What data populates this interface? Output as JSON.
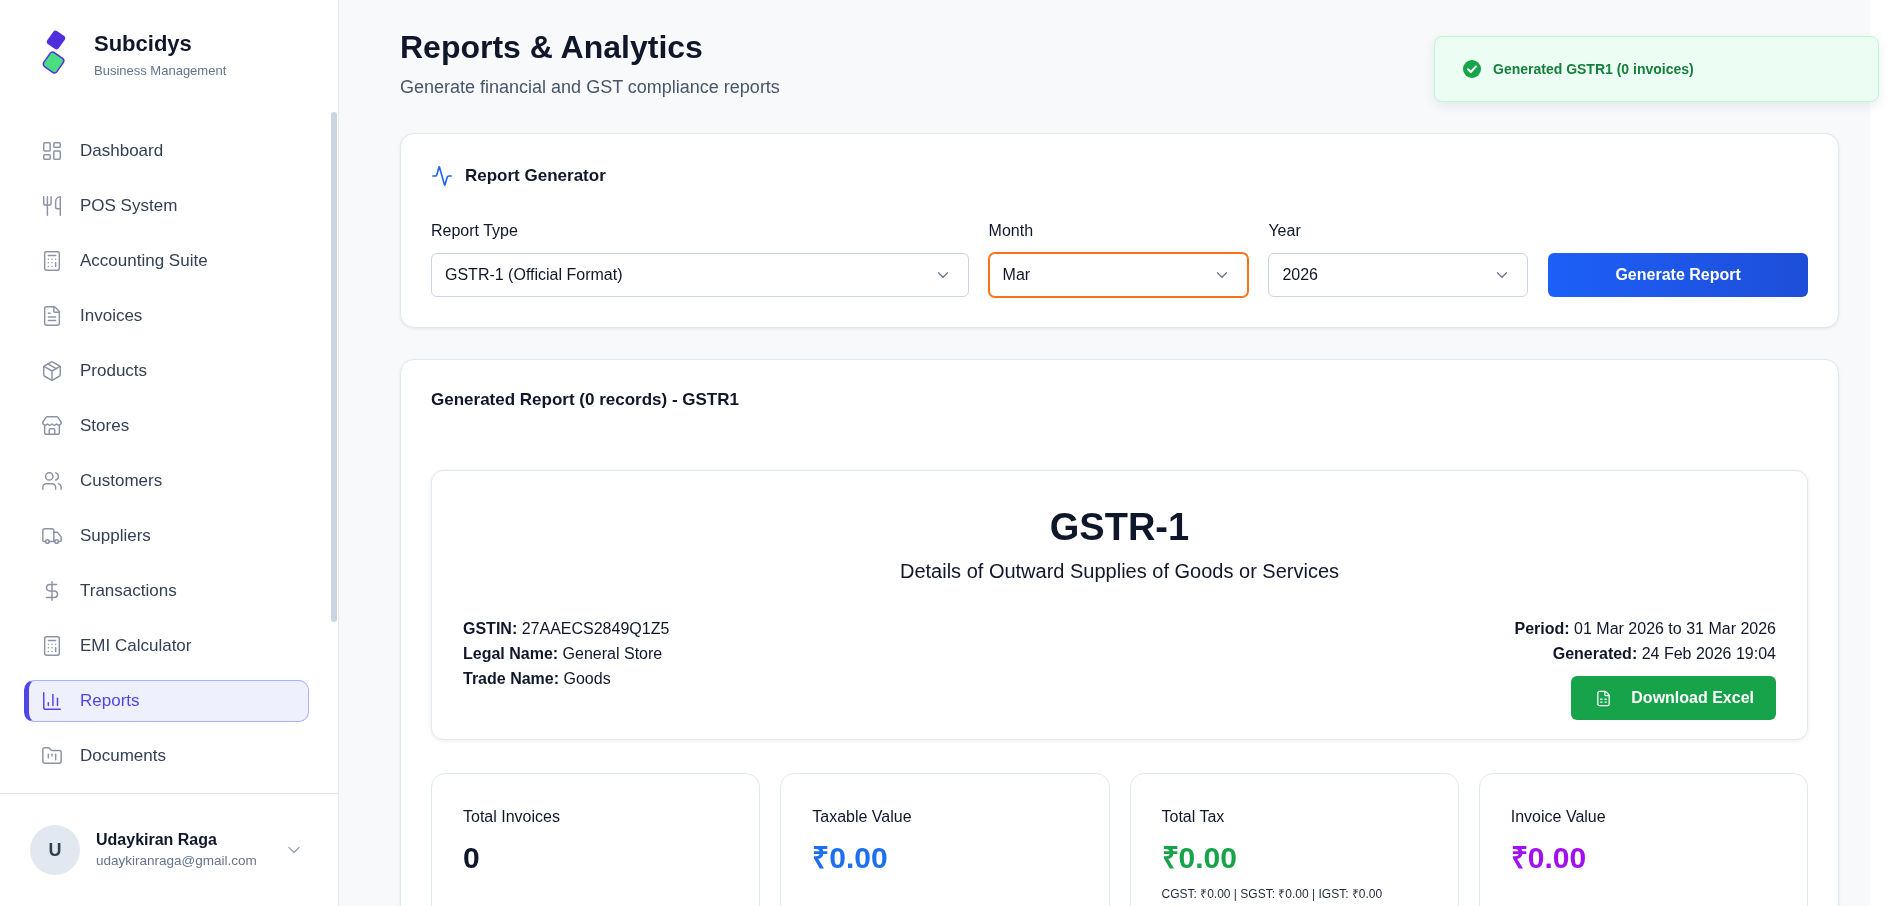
{
  "sidebar": {
    "brand": {
      "name": "Subcidys",
      "tagline": "Business Management"
    },
    "nav_items": [
      {
        "label": "Dashboard",
        "selected": false
      },
      {
        "label": "POS System",
        "selected": false
      },
      {
        "label": "Accounting Suite",
        "selected": false
      },
      {
        "label": "Invoices",
        "selected": false
      },
      {
        "label": "Products",
        "selected": false
      },
      {
        "label": "Stores",
        "selected": false
      },
      {
        "label": "Customers",
        "selected": false
      },
      {
        "label": "Suppliers",
        "selected": false
      },
      {
        "label": "Transactions",
        "selected": false
      },
      {
        "label": "EMI Calculator",
        "selected": false
      },
      {
        "label": "Reports",
        "selected": true
      },
      {
        "label": "Documents",
        "selected": false
      }
    ],
    "user": {
      "initial": "U",
      "name": "Udaykiran Raga",
      "email": "udaykiranraga@gmail.com"
    }
  },
  "header": {
    "title": "Reports & Analytics",
    "subtitle": "Generate financial and GST compliance reports"
  },
  "toast": {
    "message": "Generated GSTR1 (0 invoices)"
  },
  "report_generator": {
    "title": "Report Generator",
    "fields": [
      {
        "label": "Report Type",
        "value": "GSTR-1 (Official Format)",
        "focused": false
      },
      {
        "label": "Month",
        "value": "Mar",
        "focused": true
      },
      {
        "label": "Year",
        "value": "2026",
        "focused": false
      }
    ],
    "button": "Generate Report"
  },
  "generated_report": {
    "title": "Generated Report (0 records) - GSTR1",
    "header": {
      "title": "GSTR-1",
      "subtitle": "Details of Outward Supplies of Goods or Services",
      "left_details": [
        "**GSTIN:** 27AAECS2849Q1Z5",
        "**Legal Name:** General Store",
        "**Trade Name:** Goods"
      ],
      "right_details": [
        "**Period:** 01 Mar 2026 to 31 Mar 2026",
        "**Generated:** 24 Feb 2026 19:04"
      ],
      "button": "Download Excel"
    },
    "stats": [
      {
        "label": "Total Invoices",
        "value": "0",
        "color": "#0f172a"
      },
      {
        "label": "Taxable Value",
        "value": "₹0.00",
        "color": "#1d6ff0"
      },
      {
        "label": "Total Tax",
        "value": "₹0.00",
        "color": "#16a34a",
        "note": "CGST: ₹0.00 | SGST: ₹0.00 | IGST: ₹0.00"
      },
      {
        "label": "Invoice Value",
        "value": "₹0.00",
        "color": "#a10ff2"
      }
    ]
  }
}
